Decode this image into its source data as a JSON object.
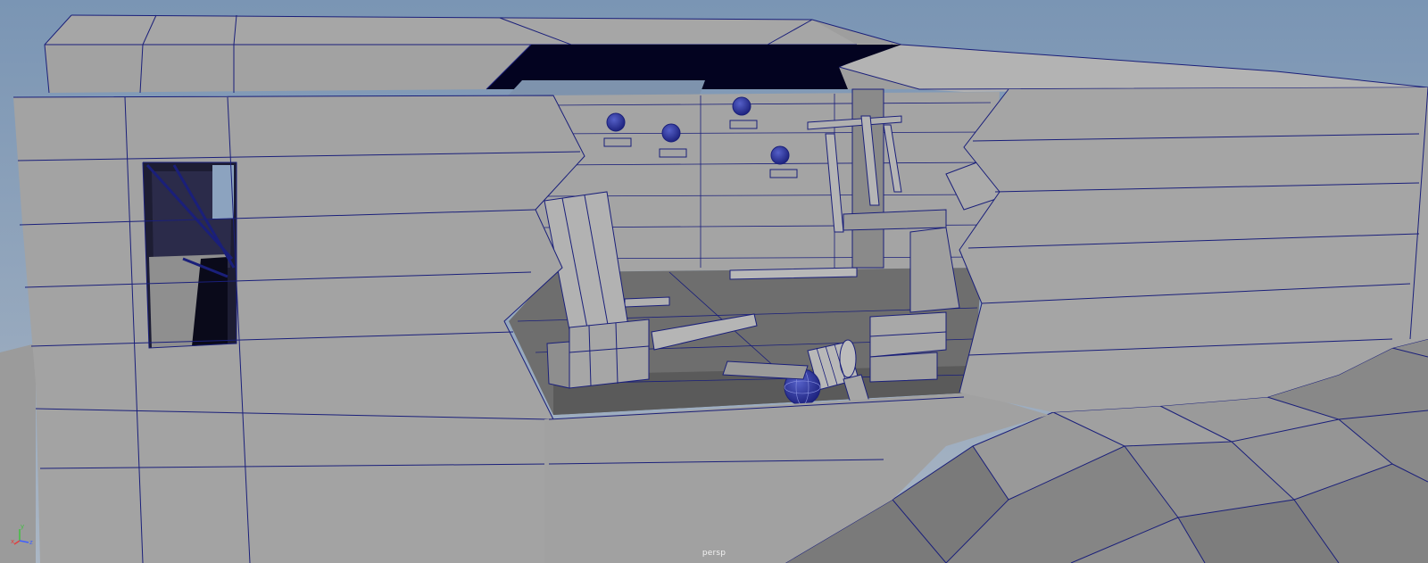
{
  "viewport": {
    "camera_label": "persp",
    "axes": {
      "x": "x",
      "y": "y",
      "z": "z"
    }
  },
  "colors": {
    "sky_top": "#7d97b5",
    "sky_bottom": "#a9b6c6",
    "mesh_light": "#a8a8a8",
    "mesh_mid": "#8c8c8c",
    "mesh_dark": "#5f5f5f",
    "wireframe": "#1a1f7a",
    "opening_dark": "#030320",
    "axis_x": "#e04040",
    "axis_y": "#40c040",
    "axis_z": "#4060ff"
  }
}
